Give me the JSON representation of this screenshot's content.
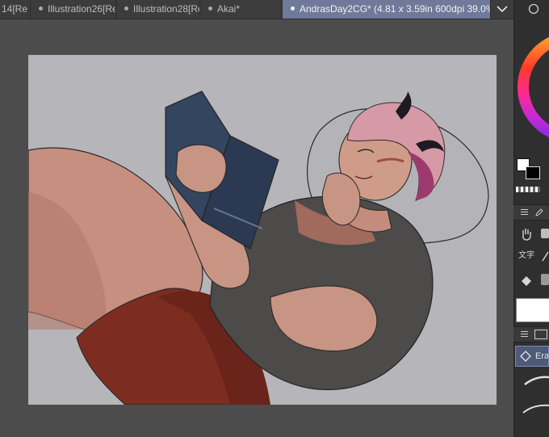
{
  "tabs": [
    {
      "label": "14[Re"
    },
    {
      "label": "Illustration26[Re"
    },
    {
      "label": "Illustration28[Re"
    },
    {
      "label": "Akai*"
    },
    {
      "label": "AndrasDay2CG* (4.81 x 3.59in 600dpi 39.0%)"
    }
  ],
  "icons": {
    "tab_menu": "chevron-down-icon",
    "panel_menu": "hamburger-icon",
    "hand_tool": "hand-icon",
    "text_tool": "text-icon",
    "fill_tool": "fill-bucket-icon",
    "eraser": "eraser-icon"
  },
  "tool_labels": {
    "text": "文字",
    "eraser": "Era"
  },
  "colors": {
    "canvas_bg": "#b6b5ba",
    "workspace_bg": "#4c4c4c",
    "active_tab": "#6f7a9a",
    "main_color": "#ffffff",
    "sub_color": "#000000"
  }
}
